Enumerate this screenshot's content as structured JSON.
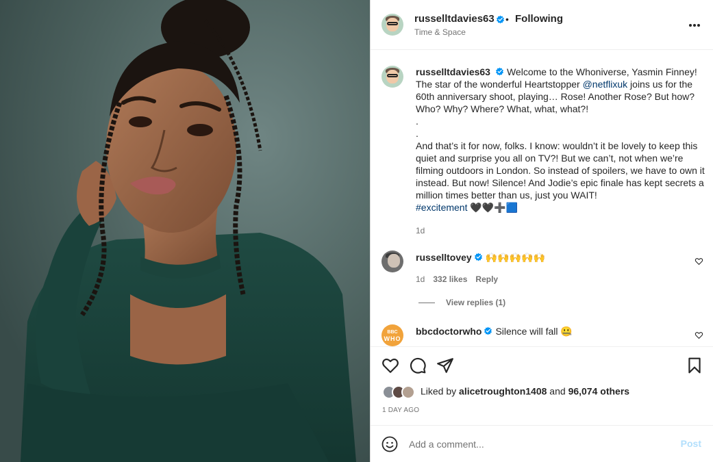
{
  "post": {
    "author": "russelltdavies63",
    "separator": "•",
    "follow_status": "Following",
    "subtitle": "Time & Space",
    "more_icon": "more-horizontal-icon",
    "caption_part1": "Welcome to the Whoniverse, Yasmin Finney! The star of the wonderful Heartstopper ",
    "caption_mention": "@netflixuk",
    "caption_part2": " joins us for the 60th anniversary shoot, playing… Rose! Another Rose? But how? Who? Why? Where? What, what, what?!\n.\n.\nAnd that’s it for now, folks. I know: wouldn’t it be lovely to keep this quiet and surprise you all on TV?! But we can’t, not when we’re filming outdoors in London. So instead of spoilers, we have to own it instead. But now! Silence! And Jodie’s epic finale has kept secrets a million times better than us, just you WAIT!",
    "caption_hashtag": "#excitement",
    "caption_emojis": " 🖤🖤➕🟦",
    "caption_time": "1d"
  },
  "comments": [
    {
      "author": "russelltovey",
      "text": "🙌🙌🙌🙌🙌",
      "time": "1d",
      "likes": "332 likes",
      "reply": "Reply",
      "view_replies": "View replies (1)"
    },
    {
      "author": "bbcdoctorwho",
      "text": "Silence will fall 🤐",
      "avatar_text1": "BBC",
      "avatar_text2": "WHO"
    }
  ],
  "likes": {
    "prefix": "Liked by ",
    "user": "alicetroughton1408",
    "middle": " and ",
    "count": "96,074 others"
  },
  "date": "1 DAY AGO",
  "add_comment": {
    "placeholder": "Add a comment...",
    "post_label": "Post"
  },
  "colors": {
    "verified": "#0095f6",
    "link": "#00376b",
    "post_disabled": "#b2dffc"
  }
}
